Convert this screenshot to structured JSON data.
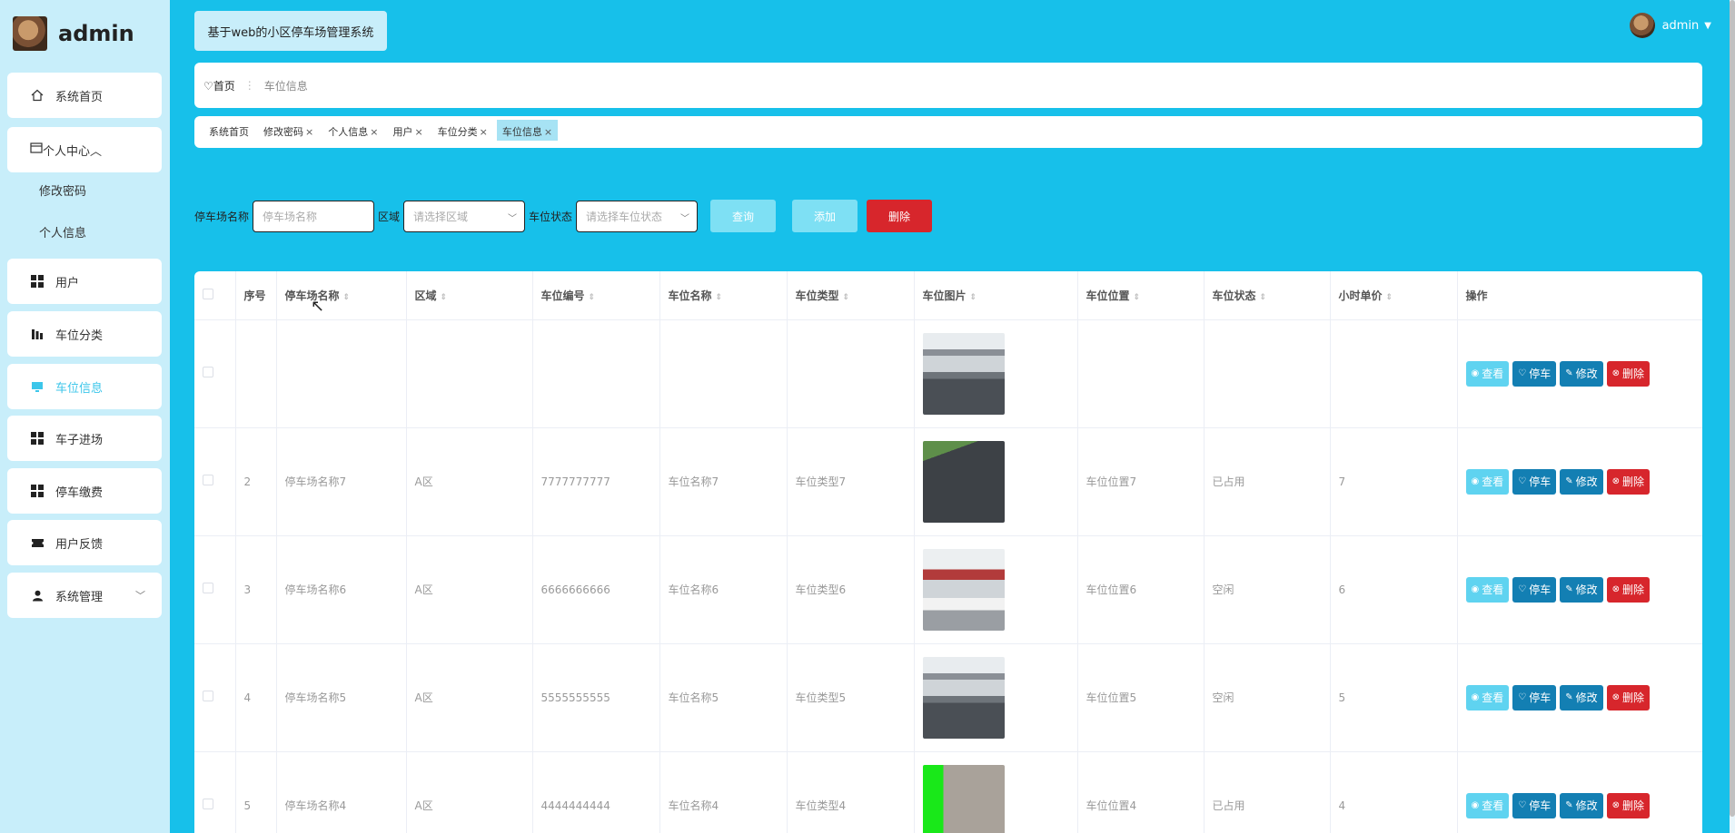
{
  "sidebar": {
    "username": "admin",
    "items": [
      {
        "label": "系统首页",
        "icon": "home-icon"
      },
      {
        "label": "个人中心",
        "icon": "card-icon"
      },
      {
        "label": "用户",
        "icon": "grid-icon"
      },
      {
        "label": "车位分类",
        "icon": "bars-icon"
      },
      {
        "label": "车位信息",
        "icon": "monitor-icon"
      },
      {
        "label": "车子进场",
        "icon": "grid-icon"
      },
      {
        "label": "停车缴费",
        "icon": "grid-icon"
      },
      {
        "label": "用户反馈",
        "icon": "ticket-icon"
      },
      {
        "label": "系统管理",
        "icon": "user-icon"
      }
    ],
    "sub_items": [
      "修改密码",
      "个人信息"
    ]
  },
  "header": {
    "system_title": "基于web的小区停车场管理系统",
    "user": "admin"
  },
  "breadcrumb": {
    "home": "首页",
    "current": "车位信息"
  },
  "tabs": [
    {
      "label": "系统首页",
      "closable": false
    },
    {
      "label": "修改密码",
      "closable": true
    },
    {
      "label": "个人信息",
      "closable": true
    },
    {
      "label": "用户",
      "closable": true
    },
    {
      "label": "车位分类",
      "closable": true
    },
    {
      "label": "车位信息",
      "closable": true
    }
  ],
  "search": {
    "name_label": "停车场名称",
    "name_placeholder": "停车场名称",
    "area_label": "区域",
    "area_placeholder": "请选择区域",
    "status_label": "车位状态",
    "status_placeholder": "请选择车位状态",
    "query": "查询",
    "add": "添加",
    "delete": "删除"
  },
  "table": {
    "columns": [
      "序号",
      "停车场名称",
      "区域",
      "车位编号",
      "车位名称",
      "车位类型",
      "车位图片",
      "车位位置",
      "车位状态",
      "小时单价",
      "操作"
    ],
    "rows": [
      {
        "idx": "",
        "name": "",
        "area": "",
        "code": "",
        "spot": "",
        "type": "",
        "pos": "",
        "status": "",
        "price": ""
      },
      {
        "idx": "2",
        "name": "停车场名称7",
        "area": "A区",
        "code": "7777777777",
        "spot": "车位名称7",
        "type": "车位类型7",
        "pos": "车位位置7",
        "status": "已占用",
        "price": "7"
      },
      {
        "idx": "3",
        "name": "停车场名称6",
        "area": "A区",
        "code": "6666666666",
        "spot": "车位名称6",
        "type": "车位类型6",
        "pos": "车位位置6",
        "status": "空闲",
        "price": "6"
      },
      {
        "idx": "4",
        "name": "停车场名称5",
        "area": "A区",
        "code": "5555555555",
        "spot": "车位名称5",
        "type": "车位类型5",
        "pos": "车位位置5",
        "status": "空闲",
        "price": "5"
      },
      {
        "idx": "5",
        "name": "停车场名称4",
        "area": "A区",
        "code": "4444444444",
        "spot": "车位名称4",
        "type": "车位类型4",
        "pos": "车位位置4",
        "status": "已占用",
        "price": "4"
      }
    ],
    "actions": {
      "view": "查看",
      "park": "停车",
      "edit": "修改",
      "delete": "删除"
    }
  },
  "colors": {
    "accent": "#17c0ea",
    "sidebar": "#c8eefa",
    "danger": "#d7262c",
    "primary": "#137fb3"
  }
}
